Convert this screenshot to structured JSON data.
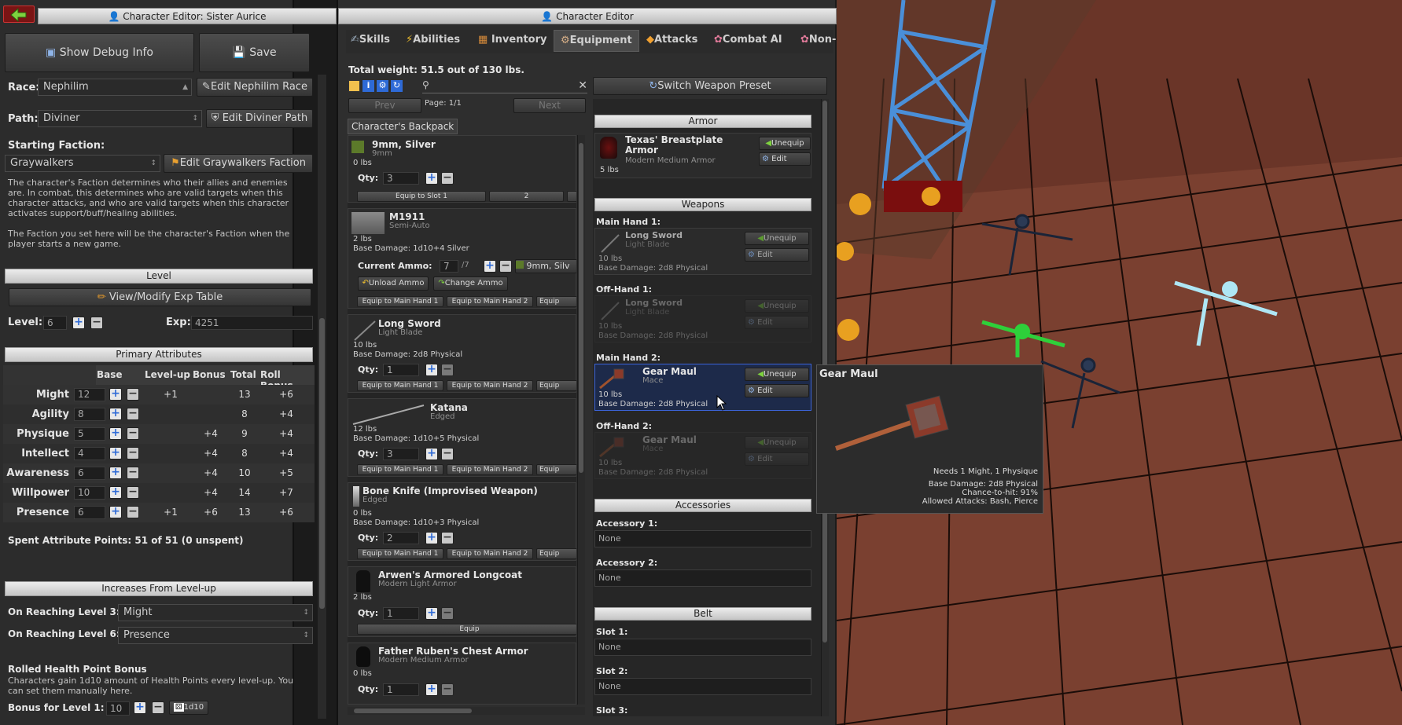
{
  "colors": {
    "accent": "#2e6ad6",
    "selected_border": "#3b63d9",
    "back_button": "#7a1414"
  },
  "left": {
    "title": "Character Editor: Sister Aurice",
    "show_debug": "Show Debug Info",
    "save": "Save",
    "race_label": "Race:",
    "race_value": "Nephilim",
    "edit_race": "Edit Nephilim Race",
    "path_label": "Path:",
    "path_value": "Diviner",
    "edit_path": "Edit Diviner Path",
    "faction_label": "Starting Faction:",
    "faction_value": "Graywalkers",
    "edit_faction": "Edit Graywalkers Faction",
    "faction_desc1": "The character's Faction determines who their allies and enemies are. In combat, this determines who are valid targets when this character attacks, and who are valid targets when this character activates support/buff/healing abilities.",
    "faction_desc2": "The Faction you set here will be the character's Faction when the player starts a new game.",
    "level_header": "Level",
    "view_exp": "View/Modify Exp Table",
    "level_label": "Level:",
    "level_value": "6",
    "exp_label": "Exp:",
    "exp_value": "4251",
    "primary_header": "Primary Attributes",
    "cols": {
      "base": "Base",
      "levelup": "Level-up",
      "bonus": "Bonus",
      "total": "Total",
      "roll": "Roll Bonus"
    },
    "attributes": [
      {
        "name": "Might",
        "base": "12",
        "levelup": "+1",
        "bonus": "",
        "total": "13",
        "roll": "+6"
      },
      {
        "name": "Agility",
        "base": "8",
        "levelup": "",
        "bonus": "",
        "total": "8",
        "roll": "+4"
      },
      {
        "name": "Physique",
        "base": "5",
        "levelup": "",
        "bonus": "+4",
        "total": "9",
        "roll": "+4"
      },
      {
        "name": "Intellect",
        "base": "4",
        "levelup": "",
        "bonus": "+4",
        "total": "8",
        "roll": "+4"
      },
      {
        "name": "Awareness",
        "base": "6",
        "levelup": "",
        "bonus": "+4",
        "total": "10",
        "roll": "+5"
      },
      {
        "name": "Willpower",
        "base": "10",
        "levelup": "",
        "bonus": "+4",
        "total": "14",
        "roll": "+7"
      },
      {
        "name": "Presence",
        "base": "6",
        "levelup": "+1",
        "bonus": "+6",
        "total": "13",
        "roll": "+6"
      }
    ],
    "spent": "Spent Attribute Points: 51 of 51 (0 unspent)",
    "increases_header": "Increases From Level-up",
    "lvl3_label": "On Reaching Level 3:",
    "lvl3_value": "Might",
    "lvl6_label": "On Reaching Level 6:",
    "lvl6_value": "Presence",
    "rolled_title": "Rolled Health Point Bonus",
    "rolled_desc": "Characters gain 1d10 amount of Health Points every level-up. You can set them manually here.",
    "bonus_l1_label": "Bonus for Level 1:",
    "bonus_l1_value": "10",
    "dice": "1d10"
  },
  "editor": {
    "title": "Character Editor",
    "tabs": [
      "Skills",
      "Abilities",
      "Inventory",
      "Equipment",
      "Attacks",
      "Combat AI",
      "Non-"
    ],
    "weight": "Total weight: 51.5 out of 130 lbs.",
    "page": "Page: 1/1",
    "prev": "Prev",
    "next": "Next",
    "backpack_tab": "Character's Backpack",
    "switch_preset": "Switch Weapon Preset",
    "qty_label": "Qty:",
    "items": {
      "silver": {
        "name": "9mm, Silver",
        "sub": "9mm",
        "weight": "0 lbs",
        "qty": "3",
        "btn1": "Equip to Slot 1",
        "btn2": "2"
      },
      "m1911": {
        "name": "M1911",
        "sub": "Semi-Auto",
        "weight": "2 lbs",
        "dmg": "Base Damage: 1d10+4 Silver",
        "ammo_label": "Current Ammo:",
        "ammo_cur": "7",
        "ammo_max": "/7",
        "ammo_type": "9mm, Silv",
        "unload": "Unload Ammo",
        "change": "Change Ammo",
        "eq1": "Equip to Main Hand 1",
        "eq2": "Equip to Main Hand 2",
        "eq3": "Equip"
      },
      "longsword": {
        "name": "Long Sword",
        "sub": "Light Blade",
        "weight": "10 lbs",
        "dmg": "Base Damage: 2d8 Physical",
        "qty": "1",
        "eq1": "Equip to Main Hand 1",
        "eq2": "Equip to Main Hand 2",
        "eq3": "Equip"
      },
      "katana": {
        "name": "Katana",
        "sub": "Edged",
        "weight": "12 lbs",
        "dmg": "Base Damage: 1d10+5 Physical",
        "qty": "3",
        "eq1": "Equip to Main Hand 1",
        "eq2": "Equip to Main Hand 2",
        "eq3": "Equip"
      },
      "boneknife": {
        "name": "Bone Knife (Improvised Weapon)",
        "sub": "Edged",
        "weight": "0 lbs",
        "dmg": "Base Damage: 1d10+3 Physical",
        "qty": "2",
        "eq1": "Equip to Main Hand 1",
        "eq2": "Equip to Main Hand 2",
        "eq3": "Equip"
      },
      "longcoat": {
        "name": "Arwen's Armored Longcoat",
        "sub": "Modern Light Armor",
        "weight": "2 lbs",
        "qty": "1",
        "eq": "Equip"
      },
      "ruben": {
        "name": "Father Ruben's Chest Armor",
        "sub": "Modern Medium Armor",
        "weight": "0 lbs",
        "qty": "1"
      }
    },
    "equip": {
      "armor_header": "Armor",
      "armor": {
        "name": "Texas' Breastplate Armor",
        "sub": "Modern Medium Armor",
        "weight": "5 lbs"
      },
      "weapons_header": "Weapons",
      "mh1_label": "Main Hand 1:",
      "mh1": {
        "name": "Long Sword",
        "sub": "Light Blade",
        "weight": "10 lbs",
        "dmg": "Base Damage: 2d8 Physical"
      },
      "oh1_label": "Off-Hand 1:",
      "oh1": {
        "name": "Long Sword",
        "sub": "Light Blade",
        "weight": "10 lbs",
        "dmg": "Base Damage: 2d8 Physical"
      },
      "mh2_label": "Main Hand 2:",
      "mh2": {
        "name": "Gear Maul",
        "sub": "Mace",
        "weight": "10 lbs",
        "dmg": "Base Damage: 2d8 Physical"
      },
      "oh2_label": "Off-Hand 2:",
      "oh2": {
        "name": "Gear Maul",
        "sub": "Mace",
        "weight": "10 lbs",
        "dmg": "Base Damage: 2d8 Physical"
      },
      "unequip": "Unequip",
      "edit": "Edit",
      "accessories_header": "Accessories",
      "acc1_label": "Accessory 1:",
      "acc1": "None",
      "acc2_label": "Accessory 2:",
      "acc2": "None",
      "belt_header": "Belt",
      "slot1_label": "Slot 1:",
      "slot1": "None",
      "slot2_label": "Slot 2:",
      "slot2": "None",
      "slot3_label": "Slot 3:"
    },
    "tooltip": {
      "title": "Gear Maul",
      "req": "Needs 1 Might, 1 Physique",
      "dmg": "Base Damage: 2d8 Physical",
      "hit": "Chance-to-hit: 91%",
      "attacks": "Allowed Attacks: Bash, Pierce"
    }
  }
}
